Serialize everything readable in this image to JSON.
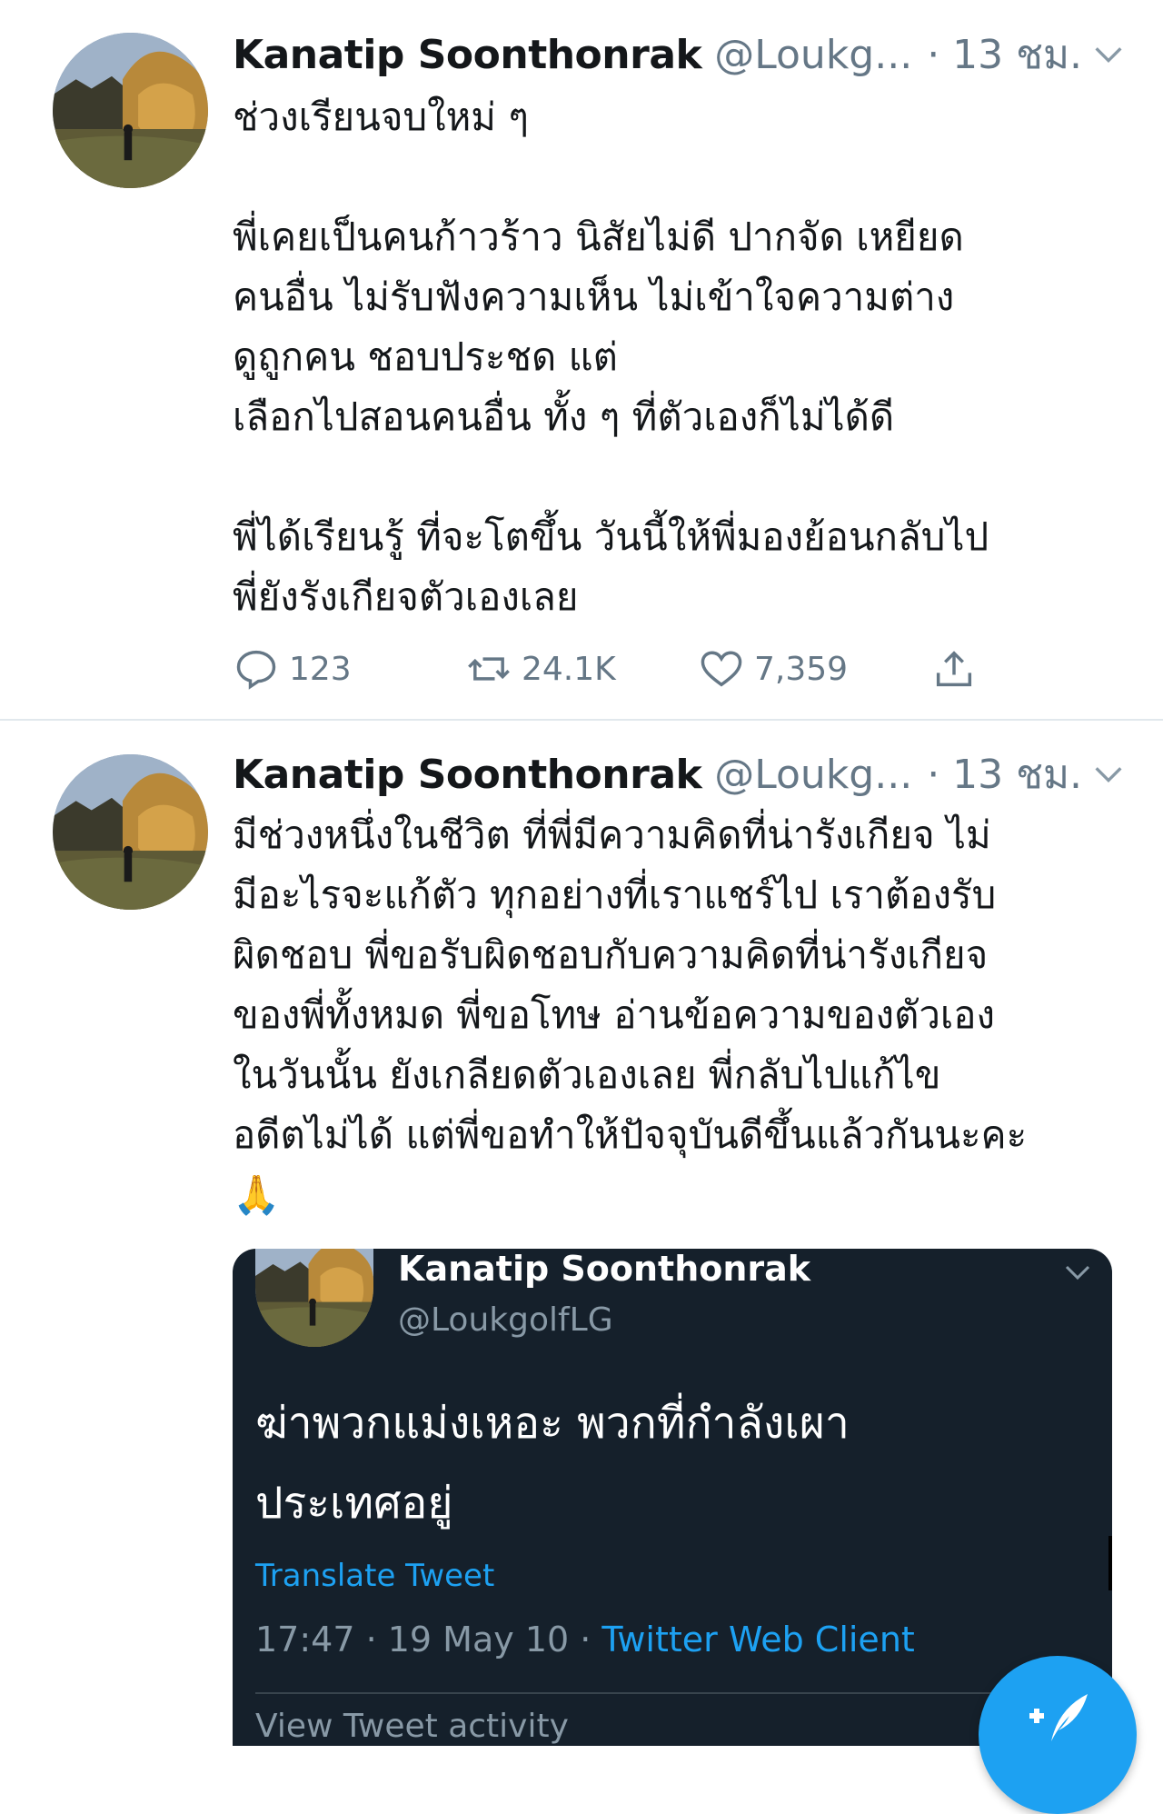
{
  "tweets": [
    {
      "author_name": "Kanatip Soonthonrak",
      "author_handle": "@Loukg...",
      "time": "· 13 ชม.",
      "lines": [
        "ช่วงเรียนจบใหม่ ๆ",
        "",
        "พี่เคยเป็นคนก้าวร้าว นิสัยไม่ดี ปากจัด เหยียด",
        "คนอื่น ไม่รับฟังความเห็น ไม่เข้าใจความต่าง",
        "ดูถูกคน ชอบประชด แต่",
        "เลือกไปสอนคนอื่น ทั้ง ๆ ที่ตัวเองก็ไม่ได้ดี",
        "",
        "พี่ได้เรียนรู้ ที่จะโตขึ้น วันนี้ให้พี่มองย้อนกลับไป",
        "พี่ยังรังเกียจตัวเองเลย"
      ],
      "replies": "123",
      "retweets": "24.1K",
      "likes": "7,359"
    },
    {
      "author_name": "Kanatip Soonthonrak",
      "author_handle": "@Loukg...",
      "time": "· 13 ชม.",
      "lines": [
        "มีช่วงหนึ่งในชีวิต ที่พี่มีความคิดที่น่ารังเกียจ ไม่",
        "มีอะไรจะแก้ตัว ทุกอย่างที่เราแชร์ไป เราต้องรับ",
        "ผิดชอบ พี่ขอรับผิดชอบกับความคิดที่น่ารังเกียจ",
        "ของพี่ทั้งหมด พี่ขอโทษ อ่านข้อความของตัวเอง",
        "ในวันนั้น ยังเกลียดตัวเองเลย พี่กลับไปแก้ไข",
        "อดีตไม่ได้ แต่พี่ขอทำให้ปัจจุบันดีขึ้นแล้วกันนะคะ",
        "🙏"
      ]
    }
  ],
  "quoted": {
    "author_name": "Kanatip Soonthonrak",
    "author_handle": "@LoukgolfLG",
    "lines": [
      "ฆ่าพวกแม่งเหอะ พวกที่กำลังเผา",
      "ประเทศอยู่"
    ],
    "translate": "Translate Tweet",
    "timestamp": "17:47 · 19 May 10 · ",
    "client": "Twitter Web Client",
    "activity": "View Tweet activity"
  },
  "icons": {
    "reply": "reply-icon",
    "retweet": "retweet-icon",
    "like": "heart-icon",
    "share": "share-icon",
    "caret": "chevron-down-icon",
    "compose": "compose-tweet-icon"
  },
  "colors": {
    "accent": "#1da1f2",
    "muted": "#657786",
    "dark_card": "#15202b"
  }
}
